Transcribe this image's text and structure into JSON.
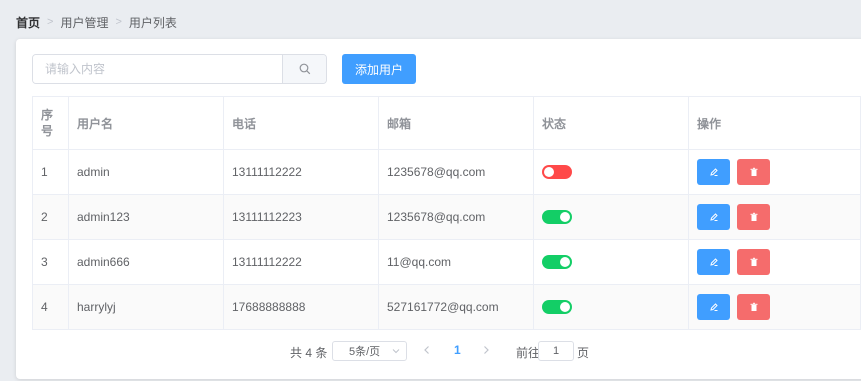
{
  "breadcrumb": [
    "首页",
    "用户管理",
    "用户列表"
  ],
  "search": {
    "placeholder": "请输入内容"
  },
  "toolbar": {
    "add_label": "添加用户"
  },
  "table": {
    "headers": [
      "序号",
      "用户名",
      "电话",
      "邮箱",
      "状态",
      "操作"
    ],
    "rows": [
      {
        "index": "1",
        "username": "admin",
        "phone": "13111112222",
        "email": "1235678@qq.com",
        "status": "off"
      },
      {
        "index": "2",
        "username": "admin123",
        "phone": "13111112223",
        "email": "1235678@qq.com",
        "status": "on"
      },
      {
        "index": "3",
        "username": "admin666",
        "phone": "13111112222",
        "email": "11@qq.com",
        "status": "on"
      },
      {
        "index": "4",
        "username": "harrylyj",
        "phone": "17688888888",
        "email": "527161772@qq.com",
        "status": "on"
      }
    ]
  },
  "pagination": {
    "total_label": "共 4 条",
    "page_size_label": "5条/页",
    "current_page": "1",
    "goto_label": "前往",
    "goto_value": "1",
    "page_unit": "页"
  },
  "colors": {
    "primary": "#409eff",
    "danger": "#f56c6c",
    "switch_on": "#13ce66",
    "switch_off": "#ff4949"
  },
  "icons": {
    "search": "search-icon",
    "edit": "edit-icon",
    "delete": "delete-icon",
    "breadcrumb_separator": "chevron-right-icon"
  }
}
